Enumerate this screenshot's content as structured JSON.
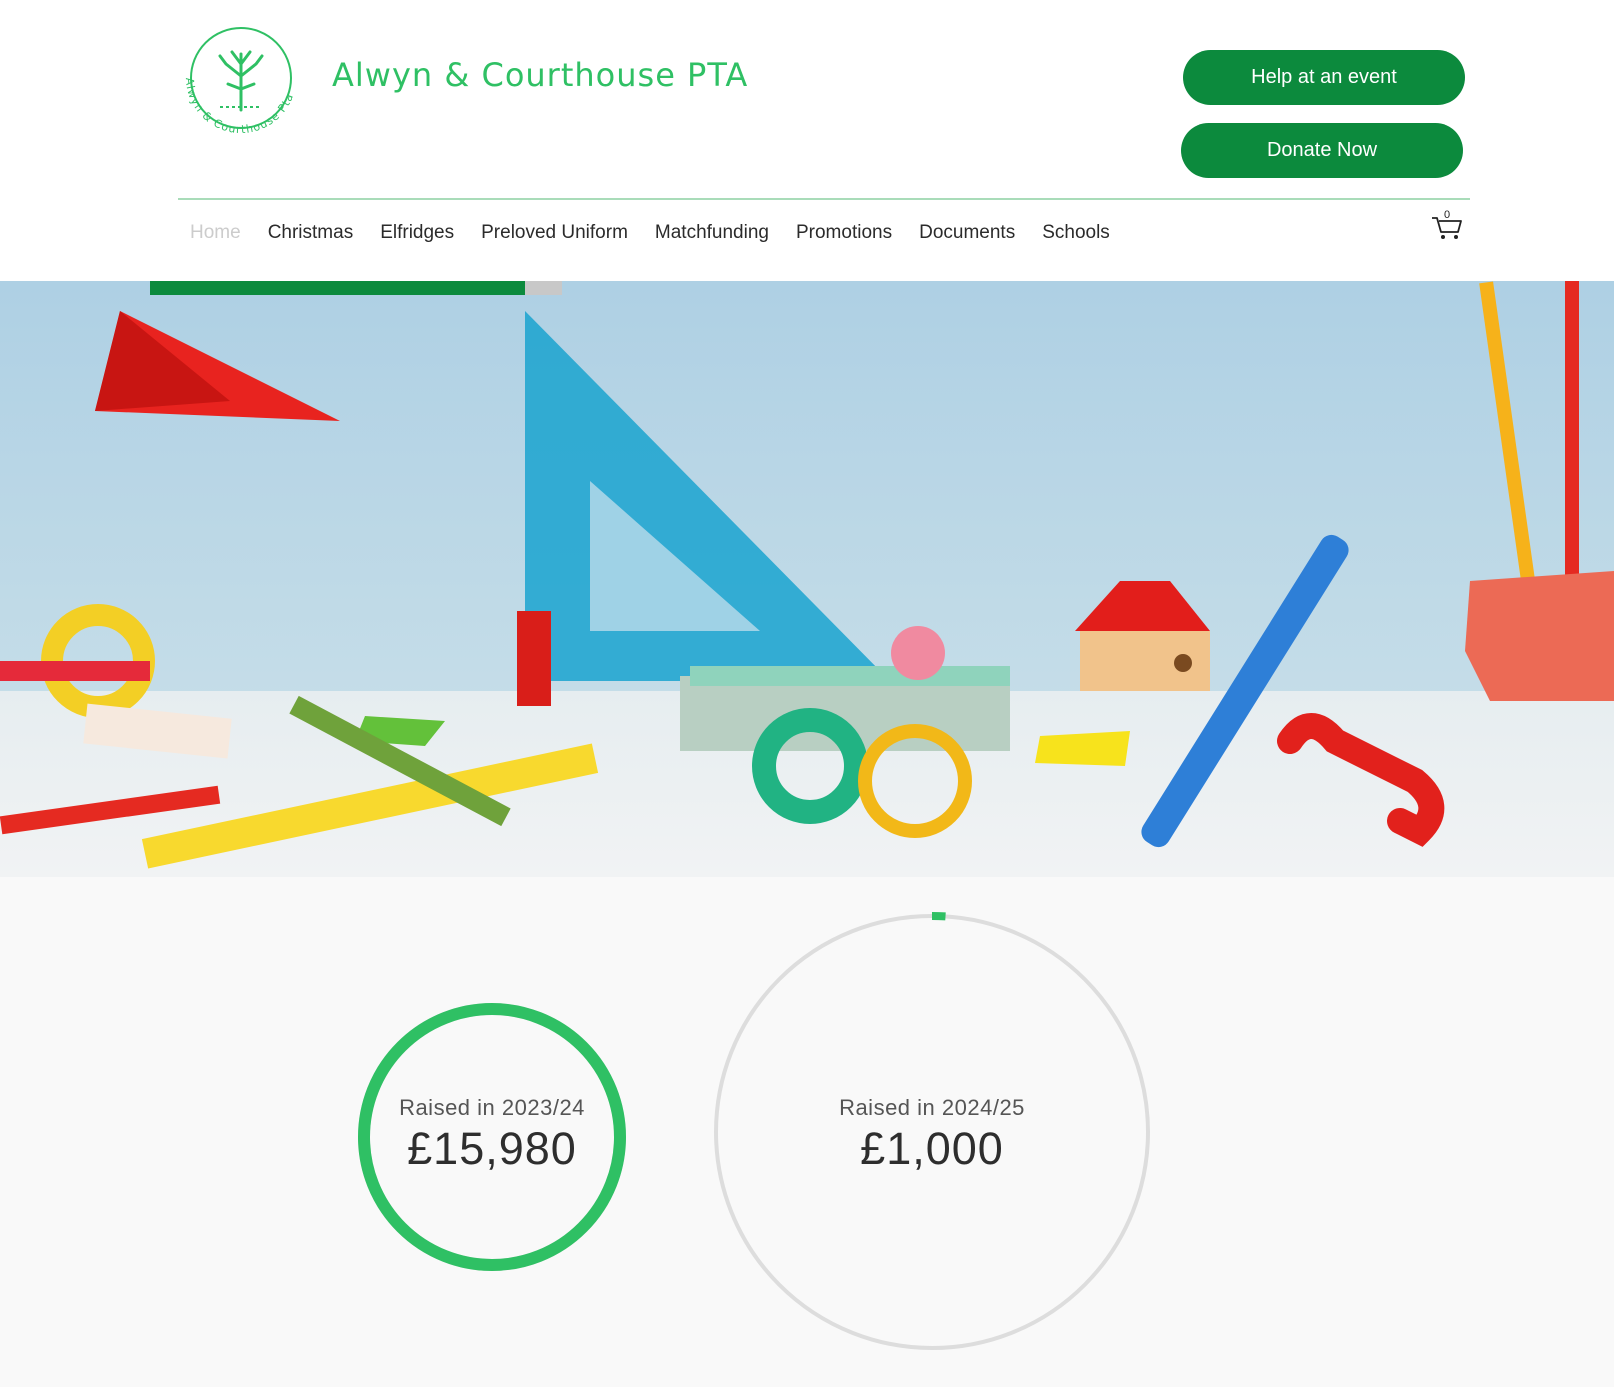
{
  "header": {
    "site_title": "Alwyn & Courthouse PTA",
    "logo_ring_text": "Alwyn & Courthouse Pta",
    "buttons": {
      "help": "Help at an event",
      "donate": "Donate Now"
    },
    "cart_count": "0"
  },
  "nav": {
    "items": [
      {
        "label": "Home",
        "active": true
      },
      {
        "label": "Christmas"
      },
      {
        "label": "Elfridges"
      },
      {
        "label": "Preloved Uniform"
      },
      {
        "label": "Matchfunding"
      },
      {
        "label": "Promotions"
      },
      {
        "label": "Documents"
      },
      {
        "label": "Schools"
      }
    ]
  },
  "page_progress": 0.91,
  "stats": {
    "items": [
      {
        "label": "Raised in 2023/24",
        "value": "£15,980",
        "progress": 1.0
      },
      {
        "label": "Raised in 2024/25",
        "value": "£1,000",
        "progress": 0.01
      }
    ]
  },
  "colors": {
    "brand_green": "#2fc064",
    "button_green": "#0c8a3d",
    "ring_track": "#dddddd",
    "stats_background": "#f9f9f9"
  },
  "icons": [
    "logo-tree-icon",
    "cart-icon"
  ]
}
